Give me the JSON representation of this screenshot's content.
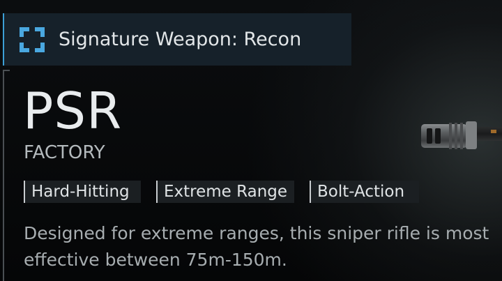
{
  "signature_banner": {
    "label": "Signature Weapon: Recon",
    "icon": "recon-target-icon",
    "accent_color": "#3c9fd6"
  },
  "weapon": {
    "name": "PSR",
    "variant": "FACTORY",
    "tags": [
      "Hard-Hitting",
      "Extreme Range",
      "Bolt-Action"
    ],
    "description": "Designed for extreme ranges, this sniper rifle is most effective between 75m-150m.",
    "image": "sniper-rifle-muzzle-brake"
  }
}
